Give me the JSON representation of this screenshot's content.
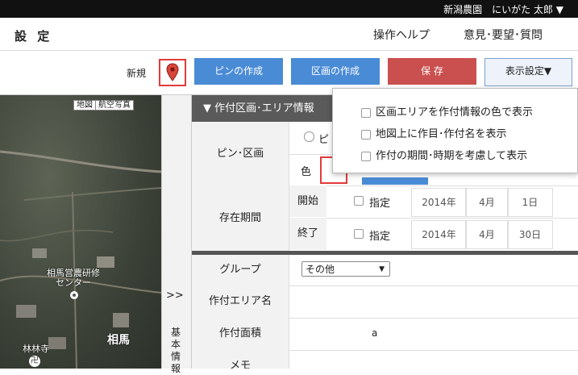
{
  "topbar": {
    "user_label": "新潟農園　にいがた 太郎 ▼"
  },
  "header": {
    "title": "設 定",
    "help_link": "操作ヘルプ",
    "feedback_link": "意見･要望･質問"
  },
  "toolbar": {
    "new_label": "新規",
    "pin_create_button": "ピンの作成",
    "area_create_button": "区画の作成",
    "save_button": "保 存",
    "display_settings_button": "表示設定▼",
    "colors": {
      "pin_btn": "#4a8bd6",
      "save_btn": "#c9504e"
    }
  },
  "map": {
    "map_type_map": "地図",
    "map_type_satellite": "航空写真",
    "label_center": "相馬営農研修\nセンター",
    "label_temple": "林林寺",
    "label_souma": "相馬"
  },
  "strip": {
    "expand_arrows": ">>",
    "basic_info": "基本情報"
  },
  "panel": {
    "section_header": "▼ 作付区画･エリア情報",
    "pin_area_label": "ピン･区画",
    "pin_radio_label": "ピ",
    "color_label": "色",
    "period_label": "存在期間",
    "start_label": "開始",
    "end_label": "終了",
    "specify_label": "指定",
    "start_year": "2014年",
    "start_month": "4月",
    "start_day": "1日",
    "end_year": "2014年",
    "end_month": "4月",
    "end_day": "30日",
    "group_label": "グループ",
    "group_value": "その他",
    "crop_area_name_label": "作付エリア名",
    "crop_area_size_label": "作付面積",
    "crop_area_unit": "a",
    "memo_label": "メモ"
  },
  "dropdown": {
    "option_1": "区画エリアを作付情報の色で表示",
    "option_2": "地図上に作目･作付名を表示",
    "option_3": "作付の期間･時期を考慮して表示"
  }
}
